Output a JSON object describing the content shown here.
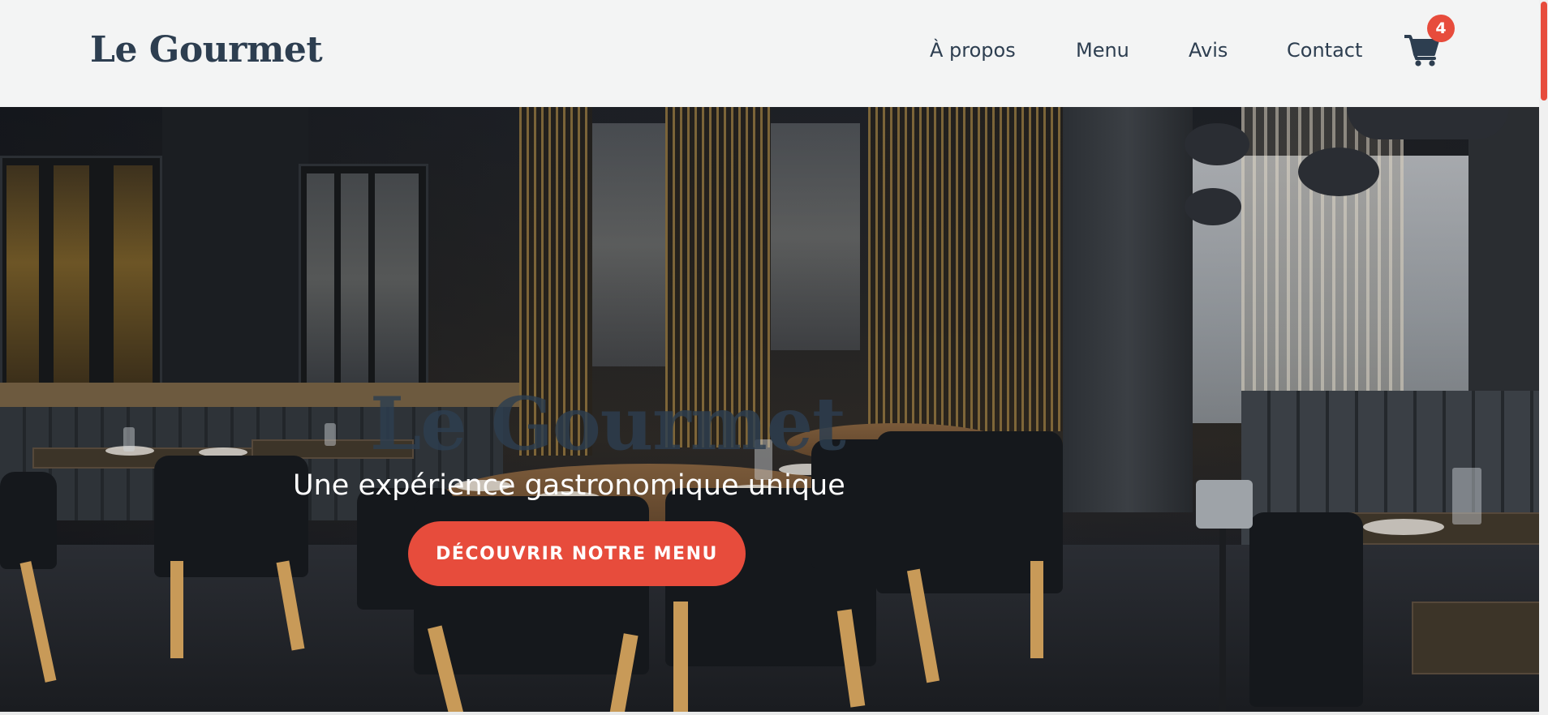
{
  "header": {
    "logo": "Le Gourmet",
    "nav": [
      {
        "label": "À propos"
      },
      {
        "label": "Menu"
      },
      {
        "label": "Avis"
      },
      {
        "label": "Contact"
      }
    ],
    "cart": {
      "icon": "shopping-cart-icon",
      "count": "4"
    }
  },
  "hero": {
    "title": "Le Gourmet",
    "subtitle": "Une expérience gastronomique unique",
    "cta_label": "DÉCOUVRIR NOTRE MENU",
    "background": "restaurant-interior-photo"
  },
  "colors": {
    "brand_dark": "#2d3e50",
    "accent": "#e74c3c",
    "header_bg": "#f3f4f4",
    "text_light": "#ffffff"
  }
}
